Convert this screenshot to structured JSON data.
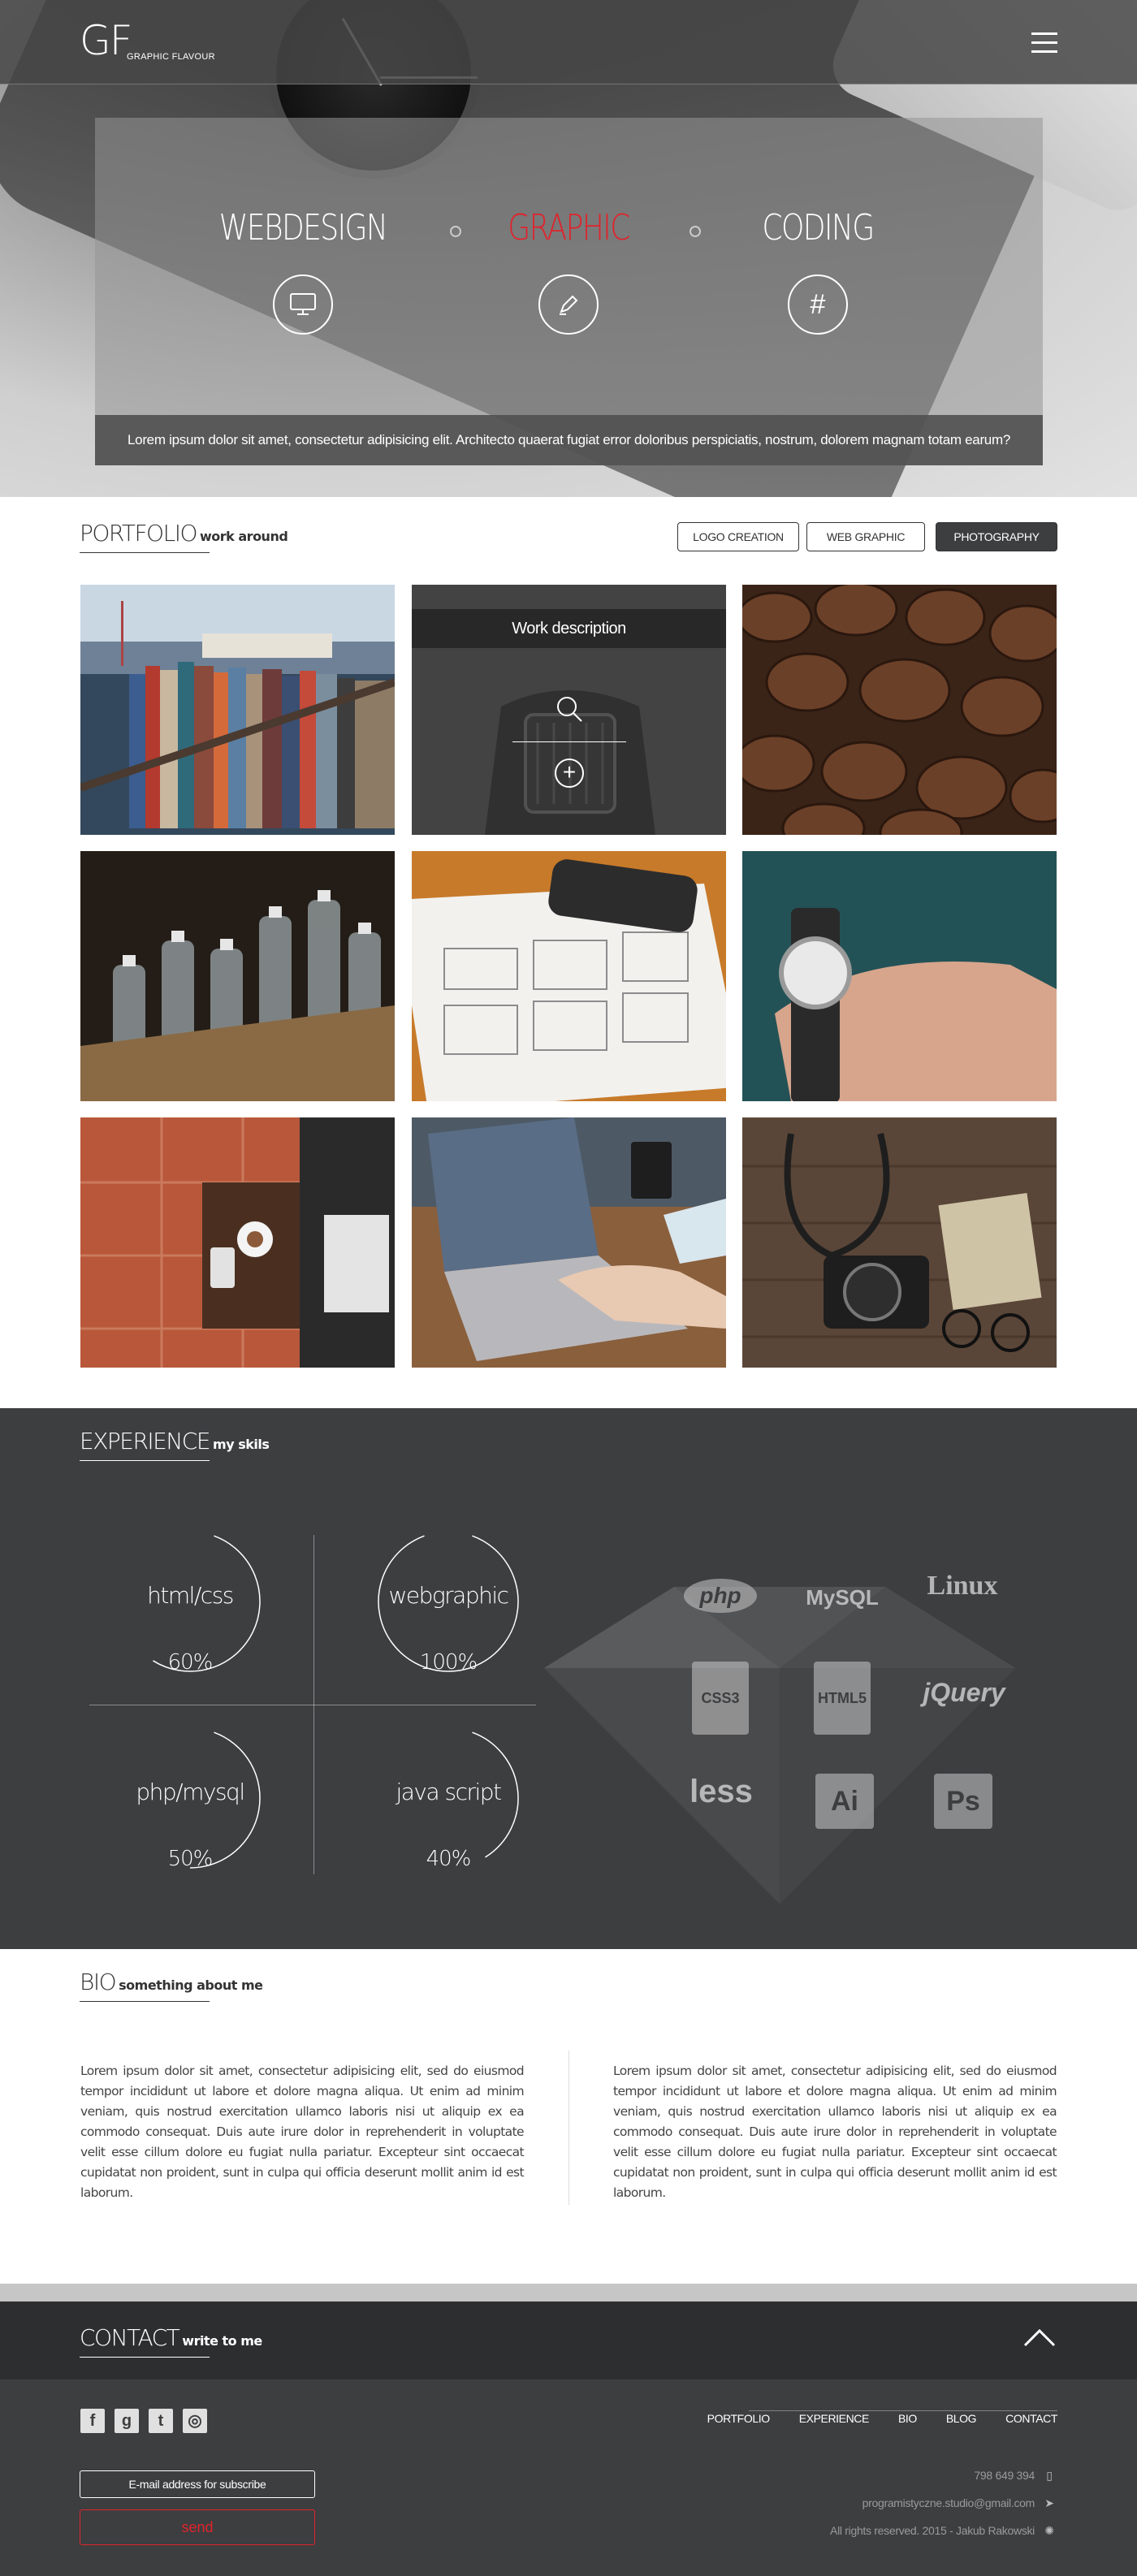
{
  "brand": {
    "logo_mark": "GF",
    "logo_text": "GRAPHIC FLAVOUR",
    "accent_color": "#e0232b",
    "dark_color": "#3d3e40"
  },
  "hero": {
    "services": [
      {
        "label": "WEBDESIGN",
        "icon": "monitor-icon",
        "active": false
      },
      {
        "label": "GRAPHIC",
        "icon": "pen-icon",
        "active": true
      },
      {
        "label": "CODING",
        "icon": "hash-icon",
        "active": false
      }
    ],
    "caption": "Lorem ipsum dolor sit amet, consectetur adipisicing elit. Architecto quaerat fugiat error doloribus perspiciatis, nostrum, dolorem magnam totam earum?"
  },
  "portfolio": {
    "title": "PORTFOLIO",
    "subtitle": "work around",
    "filters": [
      {
        "label": "LOGO CREATION",
        "active": false
      },
      {
        "label": "WEB GRAPHIC",
        "active": false
      },
      {
        "label": "PHOTOGRAPHY",
        "active": true
      }
    ],
    "hover_description": "Work description",
    "tiles": [
      "harbor-ropes",
      "vintage-car",
      "coffee-beans",
      "glass-bottles",
      "wireframe-sketch",
      "wrist-watch",
      "coffee-table",
      "laptop-typing",
      "camera-glasses"
    ]
  },
  "experience": {
    "title": "EXPERIENCE",
    "subtitle": "my skils",
    "skills": [
      {
        "name": "html/css",
        "percent": "60%",
        "value": 0.6
      },
      {
        "name": "webgraphic",
        "percent": "100%",
        "value": 1.0
      },
      {
        "name": "php/mysql",
        "percent": "50%",
        "value": 0.5
      },
      {
        "name": "java script",
        "percent": "40%",
        "value": 0.4
      }
    ],
    "tech_logos": [
      "php",
      "MySQL",
      "Linux",
      "CSS3",
      "HTML5",
      "jQuery",
      "less",
      "Ai",
      "Ps"
    ]
  },
  "bio": {
    "title": "BIO",
    "subtitle": "something about me",
    "columns": [
      "Lorem ipsum dolor sit amet, consectetur adipisicing elit, sed do eiusmod tempor incididunt ut labore et dolore magna aliqua. Ut enim ad minim veniam, quis nostrud exercitation ullamco laboris nisi ut aliquip ex ea commodo consequat. Duis aute irure dolor in reprehenderit in voluptate velit esse cillum dolore eu fugiat nulla pariatur. Excepteur sint occaecat cupidatat non proident, sunt in culpa qui officia deserunt mollit anim id est laborum.",
      "Lorem ipsum dolor sit amet, consectetur adipisicing elit, sed do eiusmod tempor incididunt ut labore et dolore magna aliqua. Ut enim ad minim veniam, quis nostrud exercitation ullamco laboris nisi ut aliquip ex ea commodo consequat. Duis aute irure dolor in reprehenderit in voluptate velit esse cillum dolore eu fugiat nulla pariatur. Excepteur sint occaecat cupidatat non proident, sunt in culpa qui officia deserunt mollit anim id est laborum."
    ]
  },
  "contact": {
    "title": "CONTACT",
    "subtitle": "write to me",
    "social": [
      {
        "name": "facebook-icon",
        "glyph": "f"
      },
      {
        "name": "google-plus-icon",
        "glyph": "g"
      },
      {
        "name": "twitter-icon",
        "glyph": "t"
      },
      {
        "name": "instagram-icon",
        "glyph": "◎"
      }
    ],
    "nav": [
      "PORTFOLIO",
      "EXPERIENCE",
      "BIO",
      "BLOG",
      "CONTACT"
    ],
    "subscribe_placeholder": "E-mail address for subscribe",
    "send_label": "send",
    "phone": "798 649 394",
    "email": "programistyczne.studio@gmail.com",
    "copyright": "All rights reserved. 2015 - Jakub Rakowski"
  }
}
